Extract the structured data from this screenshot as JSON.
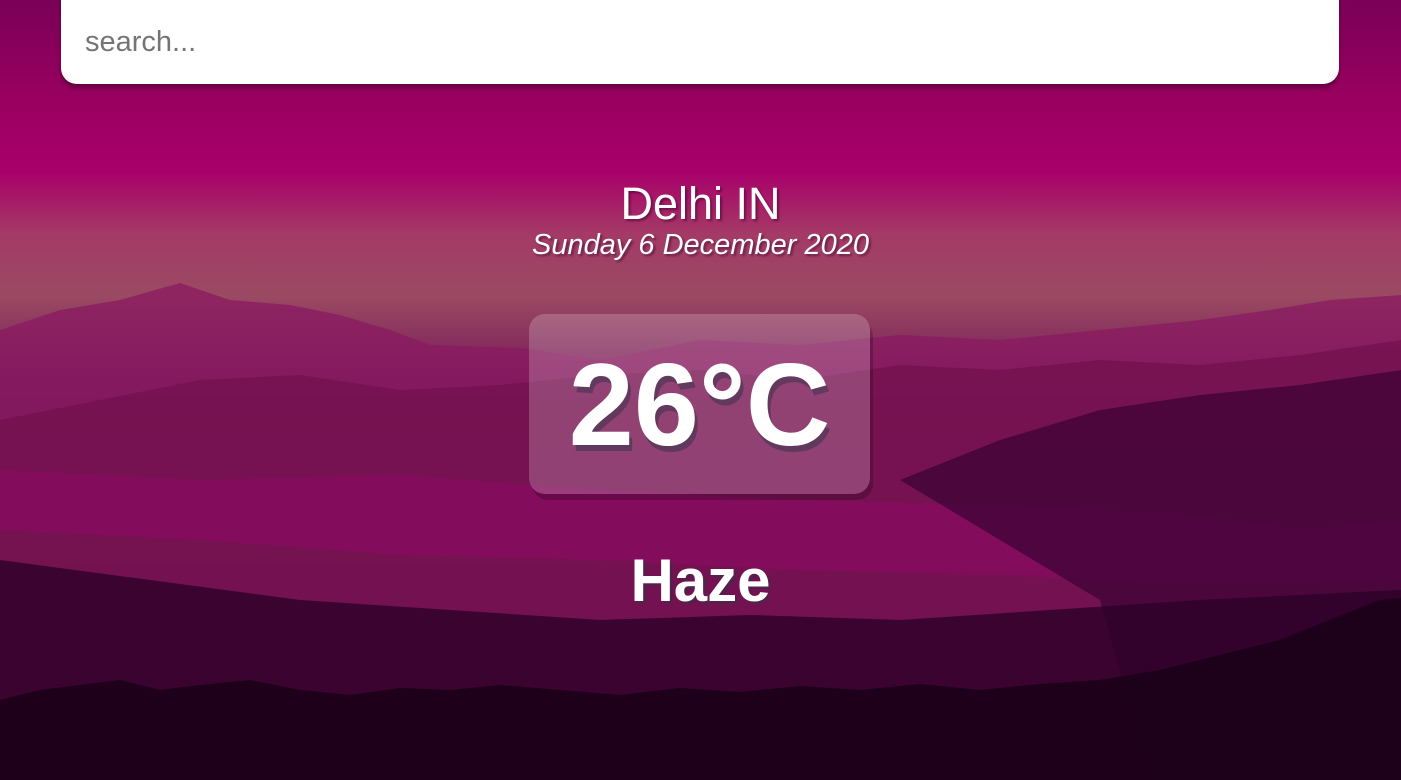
{
  "search": {
    "placeholder": "search...",
    "value": ""
  },
  "location": {
    "city": "Delhi IN",
    "date": "Sunday 6 December 2020"
  },
  "weather": {
    "temperature": "26°C",
    "condition": "Haze"
  },
  "colors": {
    "background_top": "#98005f",
    "background_bottom": "#14001a",
    "text": "#ffffff",
    "search_background": "#ffffff"
  }
}
